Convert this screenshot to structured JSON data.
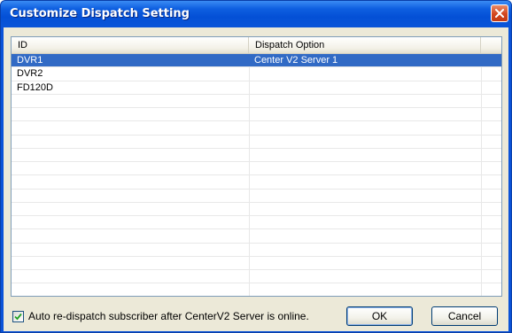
{
  "window": {
    "title": "Customize Dispatch Setting"
  },
  "list": {
    "columns": [
      "ID",
      "Dispatch Option"
    ],
    "rows": [
      {
        "id": "DVR1",
        "option": "Center V2 Server 1",
        "selected": true
      },
      {
        "id": "DVR2",
        "option": ""
      },
      {
        "id": "FD120D",
        "option": ""
      }
    ],
    "empty_row_count": 15
  },
  "footer": {
    "auto_redispatch_label": "Auto re-dispatch subscriber after CenterV2 Server is online.",
    "auto_redispatch_checked": true,
    "ok_label": "OK",
    "cancel_label": "Cancel"
  },
  "colors": {
    "titlebar": "#0b53d8",
    "selection": "#316ac5",
    "dialog_bg": "#ece9d8",
    "close_button": "#d2461f"
  },
  "icons": [
    "close-icon",
    "checkmark-icon"
  ]
}
